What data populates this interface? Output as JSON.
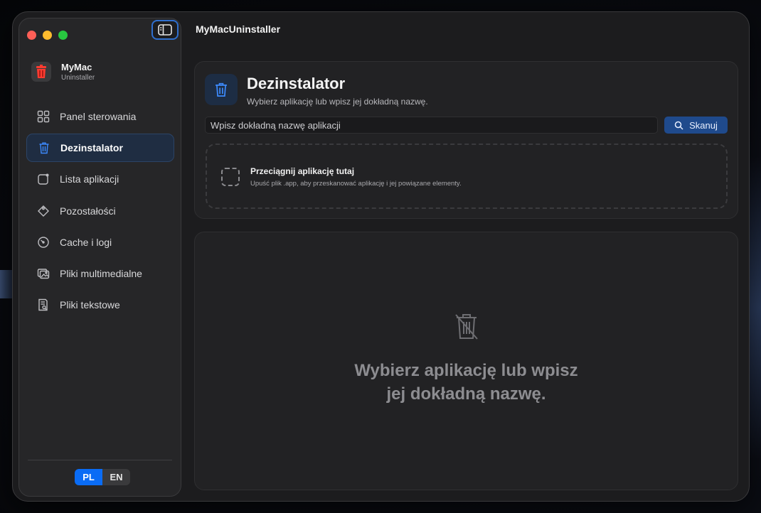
{
  "app": {
    "title": "MyMacUninstaller"
  },
  "brand": {
    "name": "MyMac",
    "subtitle": "Uninstaller"
  },
  "sidebar": {
    "items": [
      {
        "label": "Panel sterowania",
        "icon": "grid-icon"
      },
      {
        "label": "Dezinstalator",
        "icon": "trash-icon",
        "active": true
      },
      {
        "label": "Lista aplikacji",
        "icon": "app-badge-icon"
      },
      {
        "label": "Pozostałości",
        "icon": "tag-icon"
      },
      {
        "label": "Cache i logi",
        "icon": "gauge-icon"
      },
      {
        "label": "Pliki multimedialne",
        "icon": "photos-icon"
      },
      {
        "label": "Pliki tekstowe",
        "icon": "document-search-icon"
      }
    ]
  },
  "language": {
    "options": [
      "PL",
      "EN"
    ],
    "selected": "PL"
  },
  "uninstaller": {
    "title": "Dezinstalator",
    "subtitle": "Wybierz aplikację lub wpisz jej dokładną nazwę.",
    "search_placeholder": "Wpisz dokładną nazwę aplikacji",
    "scan_label": "Skanuj",
    "drop_title": "Przeciągnij aplikację tutaj",
    "drop_subtitle": "Upuść plik .app, aby przeskanować aplikację i jej powiązane elementy.",
    "empty_line1": "Wybierz aplikację lub wpisz",
    "empty_line2": "jej dokładną nazwę."
  },
  "colors": {
    "accent": "#0a6cf5",
    "scan_button": "#1f4a8c",
    "close": "#fe5f57",
    "minimize": "#febc2e",
    "zoom": "#28c840"
  }
}
